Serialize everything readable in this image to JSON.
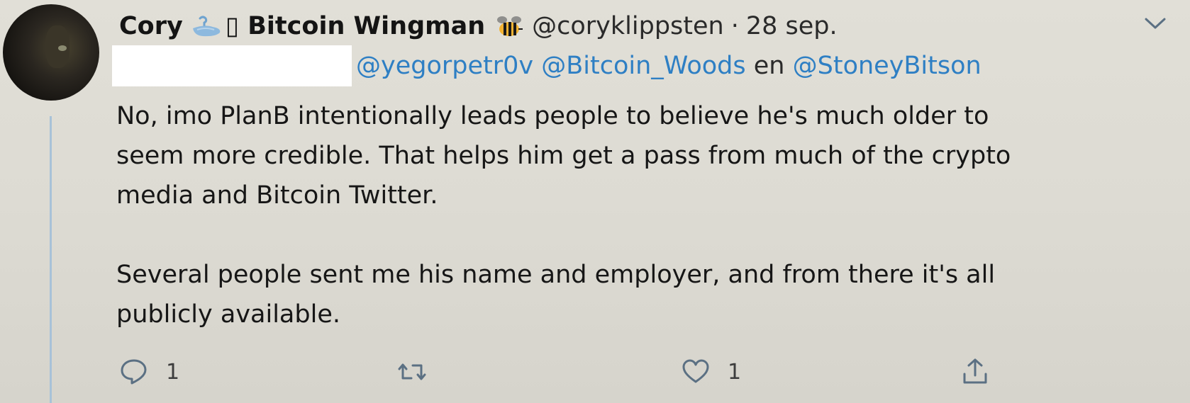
{
  "tweet": {
    "author_name": "Cory",
    "author_suffix": "▯ Bitcoin Wingman",
    "handle": "@coryklippsten",
    "separator": "·",
    "date": "28 sep.",
    "reply_to": {
      "mentions": [
        "@yegorpetr0v",
        "@Bitcoin_Woods",
        "@StoneyBitson"
      ],
      "conjunction": "en"
    },
    "paragraphs": [
      "No, imo PlanB intentionally leads people to believe he's much older to\nseem more credible.  That helps him get a pass from much of the crypto\nmedia and Bitcoin Twitter.",
      "Several people sent me his name and employer, and from there it's all\npublicly available."
    ]
  },
  "actions": {
    "reply_count": "1",
    "retweet_count": "",
    "like_count": "1"
  },
  "icons": {
    "reply": "reply-icon",
    "retweet": "retweet-icon",
    "like": "heart-icon",
    "share": "share-icon",
    "menu": "chevron-down-icon",
    "swan": "swan-icon",
    "bee": "bee-icon"
  },
  "colors": {
    "mention": "#2e7fc4",
    "thread_line": "#a8c2d8"
  }
}
